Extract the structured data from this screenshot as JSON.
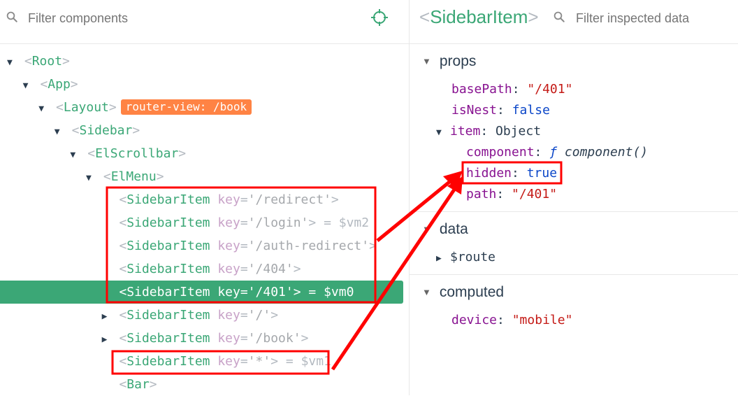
{
  "left": {
    "filter_placeholder": "Filter components",
    "tree": [
      {
        "name": "Root",
        "depth": 0,
        "arrow": "down",
        "key": null,
        "vm": null,
        "badge": null,
        "selected": false
      },
      {
        "name": "App",
        "depth": 1,
        "arrow": "down",
        "key": null,
        "vm": null,
        "badge": null,
        "selected": false
      },
      {
        "name": "Layout",
        "depth": 2,
        "arrow": "down",
        "key": null,
        "vm": null,
        "badge": "router-view: /book",
        "selected": false
      },
      {
        "name": "Sidebar",
        "depth": 3,
        "arrow": "down",
        "key": null,
        "vm": null,
        "badge": null,
        "selected": false
      },
      {
        "name": "ElScrollbar",
        "depth": 4,
        "arrow": "down",
        "key": null,
        "vm": null,
        "badge": null,
        "selected": false
      },
      {
        "name": "ElMenu",
        "depth": 5,
        "arrow": "down",
        "key": null,
        "vm": null,
        "badge": null,
        "selected": false
      },
      {
        "name": "SidebarItem",
        "depth": 6,
        "arrow": "none",
        "key": "'/redirect'",
        "vm": null,
        "badge": null,
        "selected": false
      },
      {
        "name": "SidebarItem",
        "depth": 6,
        "arrow": "none",
        "key": "'/login'",
        "vm": "$vm2",
        "badge": null,
        "selected": false
      },
      {
        "name": "SidebarItem",
        "depth": 6,
        "arrow": "none",
        "key": "'/auth-redirect'",
        "vm": null,
        "badge": null,
        "selected": false
      },
      {
        "name": "SidebarItem",
        "depth": 6,
        "arrow": "none",
        "key": "'/404'",
        "vm": null,
        "badge": null,
        "selected": false
      },
      {
        "name": "SidebarItem",
        "depth": 6,
        "arrow": "none",
        "key": "'/401'",
        "vm": "$vm0",
        "badge": null,
        "selected": true
      },
      {
        "name": "SidebarItem",
        "depth": 6,
        "arrow": "right",
        "key": "'/'",
        "vm": null,
        "badge": null,
        "selected": false
      },
      {
        "name": "SidebarItem",
        "depth": 6,
        "arrow": "right",
        "key": "'/book'",
        "vm": null,
        "badge": null,
        "selected": false
      },
      {
        "name": "SidebarItem",
        "depth": 6,
        "arrow": "none",
        "key": "'*'",
        "vm": "$vm1",
        "badge": null,
        "selected": false
      },
      {
        "name": "Bar",
        "depth": 6,
        "arrow": "none",
        "key": null,
        "vm": null,
        "badge": null,
        "selected": false
      }
    ]
  },
  "right": {
    "component_name": "SidebarItem",
    "filter_placeholder": "Filter inspected data",
    "sections": {
      "props": "props",
      "data": "data",
      "computed": "computed"
    },
    "props": {
      "basePath": {
        "key": "basePath",
        "value": "\"/401\""
      },
      "isNest": {
        "key": "isNest",
        "value": "false"
      },
      "item": {
        "key": "item",
        "value": "Object"
      },
      "component": {
        "key": "component",
        "fn_symbol": "ƒ",
        "value": "component()"
      },
      "hidden": {
        "key": "hidden",
        "value": "true"
      },
      "path": {
        "key": "path",
        "value": "\"/401\""
      }
    },
    "data": {
      "route": {
        "key": "$route"
      }
    },
    "computed": {
      "device": {
        "key": "device",
        "value": "\"mobile\""
      }
    }
  },
  "colors": {
    "vue_green": "#3ba776",
    "badge_orange": "#ff8344",
    "annotation_red": "#ff0000"
  }
}
